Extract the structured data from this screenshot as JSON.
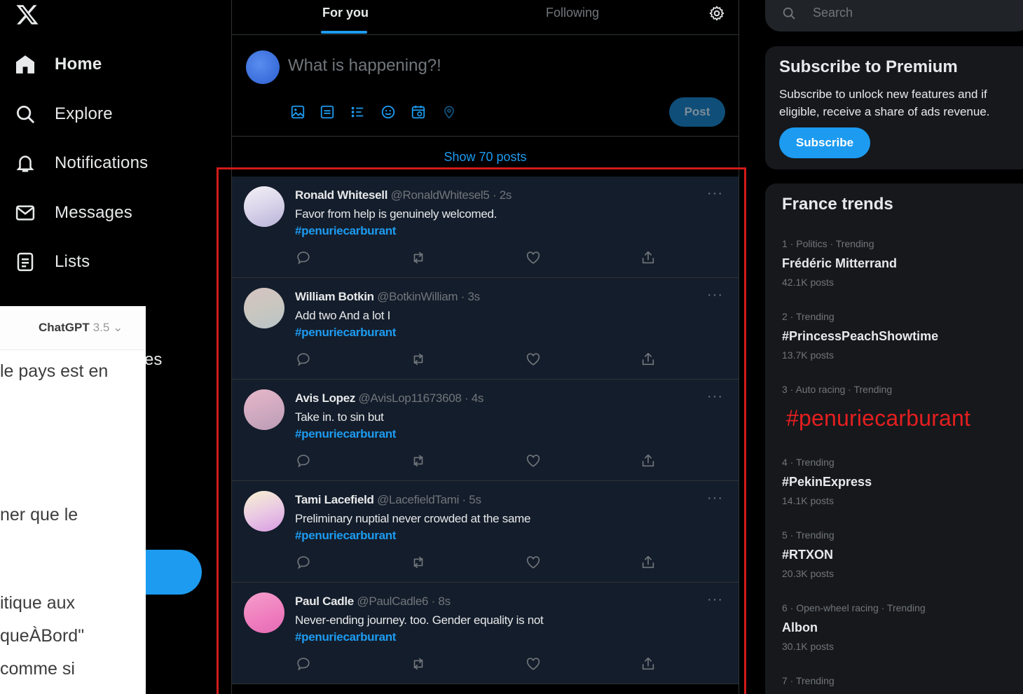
{
  "nav": {
    "items": [
      {
        "label": "Home",
        "icon": "home-icon",
        "active": true
      },
      {
        "label": "Explore",
        "icon": "search-icon"
      },
      {
        "label": "Notifications",
        "icon": "bell-icon"
      },
      {
        "label": "Messages",
        "icon": "envelope-icon"
      },
      {
        "label": "Lists",
        "icon": "list-icon"
      }
    ],
    "partial_label": "es"
  },
  "chatgpt": {
    "title": "ChatGPT",
    "version": "3.5 ⌄",
    "lines": [
      "le pays est en",
      "ner que le",
      "itique aux",
      "queÀBord\"",
      "comme si"
    ]
  },
  "tabs": {
    "for_you": "For you",
    "following": "Following"
  },
  "composer": {
    "placeholder": "What is happening?!",
    "post_label": "Post"
  },
  "show_posts": "Show 70 posts",
  "tweets": [
    {
      "name": "Ronald Whitesell",
      "meta": "@RonaldWhitesel5 · 2s",
      "text": "Favor from help is genuinely welcomed.",
      "tag": "#penuriecarburant"
    },
    {
      "name": "William Botkin",
      "meta": "@BotkinWilliam · 3s",
      "text": "Add two And a lot I",
      "tag": "#penuriecarburant"
    },
    {
      "name": "Avis Lopez",
      "meta": "@AvisLop11673608 · 4s",
      "text": "Take in. to sin but",
      "tag": "#penuriecarburant"
    },
    {
      "name": "Tami Lacefield",
      "meta": "@LacefieldTami · 5s",
      "text": "Preliminary nuptial never crowded at the same",
      "tag": "#penuriecarburant"
    },
    {
      "name": "Paul Cadle",
      "meta": "@PaulCadle6 · 8s",
      "text": "Never-ending journey. too. Gender equality is not",
      "tag": "#penuriecarburant"
    }
  ],
  "tweet_more": "···",
  "search": {
    "placeholder": "Search"
  },
  "premium": {
    "title": "Subscribe to Premium",
    "text": "Subscribe to unlock new features and if eligible, receive a share of ads revenue.",
    "button": "Subscribe"
  },
  "trends": {
    "title": "France trends",
    "items": [
      {
        "meta": "1 · Politics · Trending",
        "name": "Frédéric Mitterrand",
        "count": "42.1K posts"
      },
      {
        "meta": "2 · Trending",
        "name": "#PrincessPeachShowtime",
        "count": "13.7K posts"
      },
      {
        "meta": "3 · Auto racing · Trending",
        "name": "",
        "count": ""
      },
      {
        "meta": "4 · Trending",
        "name": "#PekinExpress",
        "count": "14.1K posts"
      },
      {
        "meta": "5 · Trending",
        "name": "#RTXON",
        "count": "20.3K posts"
      },
      {
        "meta": "6 · Open-wheel racing · Trending",
        "name": "Albon",
        "count": "30.1K posts"
      },
      {
        "meta": "7 · Trending",
        "name": "",
        "count": ""
      }
    ],
    "highlight_tag": "#penuriecarburant"
  },
  "colors": {
    "accent": "#1d9bf0",
    "highlight_red": "#d11a1a",
    "background": "#000000",
    "tweet_bg": "#141d2b"
  },
  "avatar_gradients": [
    "linear-gradient(160deg,#f3f1f6 0%,#d9d4ea 50%,#b9b3d8 100%)",
    "linear-gradient(160deg,#d6c4c1 0%,#c8c6c0 55%,#b7c4c7 100%)",
    "linear-gradient(160deg,#e7b7c9 0%,#cfa9bf 55%,#b99cb5 100%)",
    "linear-gradient(160deg,#f7f3d0 0%,#e9c6e4 55%,#d79be0 100%)",
    "linear-gradient(160deg,#f39fcc 0%,#f07fbf 55%,#e46bb4 100%)"
  ]
}
